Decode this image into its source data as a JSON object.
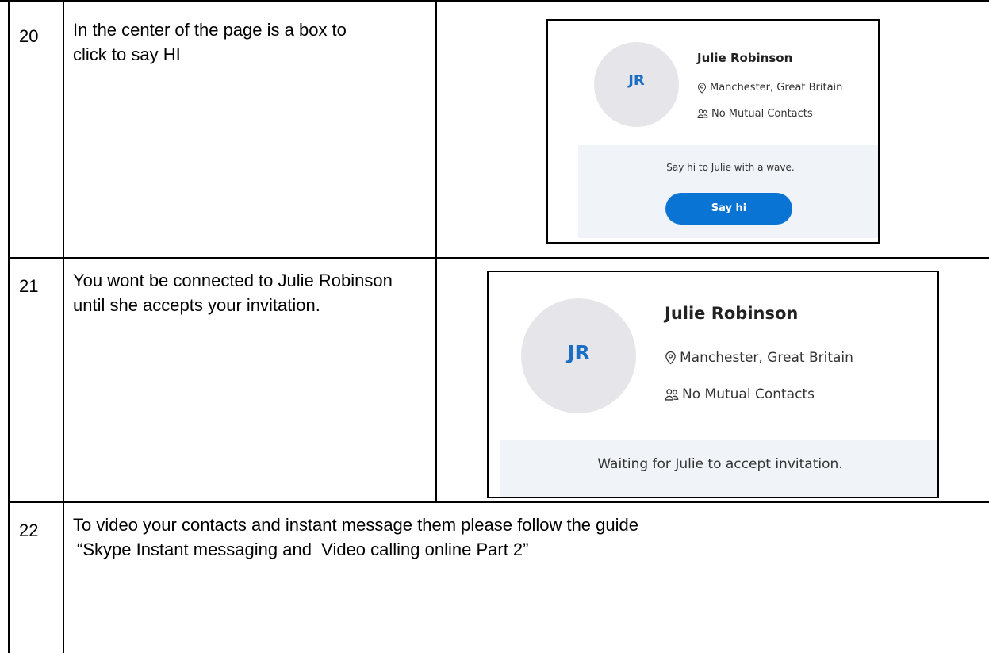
{
  "rows": [
    {
      "number": "20",
      "description": "In the center of the page is a box to click to say HI",
      "screenshot": {
        "initials": "JR",
        "name": "Julie Robinson",
        "location": "Manchester, Great Britain",
        "mutual": "No Mutual Contacts",
        "message": "Say hi to Julie with a wave.",
        "button": "Say hi"
      }
    },
    {
      "number": "21",
      "description": "You wont be connected to Julie Robinson until she accepts your invitation.",
      "screenshot": {
        "initials": "JR",
        "name": "Julie Robinson",
        "location": "Manchester, Great Britain",
        "mutual": "No Mutual Contacts",
        "message": "Waiting for Julie to accept invitation."
      }
    },
    {
      "number": "22",
      "description_line1": "To video your contacts and instant message them please follow the guide",
      "description_line2": "“Skype Instant messaging and  Video calling online Part 2”"
    }
  ],
  "colors": {
    "accent": "#0a74d4",
    "initials": "#1a6fc4",
    "avatar_bg": "#e6e6ea",
    "panel_bg": "#f0f3f8"
  },
  "icons": {
    "location": "location-pin-icon",
    "mutual": "contacts-icon"
  }
}
